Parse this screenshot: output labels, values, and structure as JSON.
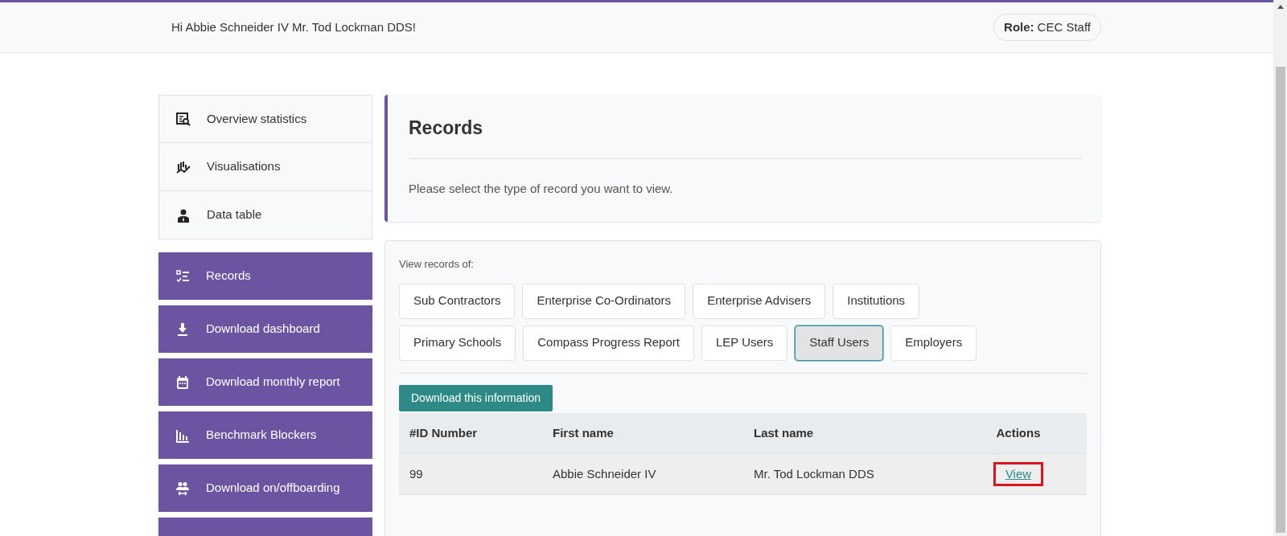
{
  "header": {
    "greeting": "Hi Abbie Schneider IV Mr. Tod Lockman DDS!",
    "role_label": "Role:",
    "role_value": "CEC Staff"
  },
  "sidebar": {
    "items": [
      {
        "kind": "light",
        "label": "Overview statistics"
      },
      {
        "kind": "light",
        "label": "Visualisations"
      },
      {
        "kind": "light",
        "label": "Data table"
      },
      {
        "kind": "purple",
        "label": "Records"
      },
      {
        "kind": "purple",
        "label": "Download dashboard"
      },
      {
        "kind": "purple",
        "label": "Download monthly report"
      },
      {
        "kind": "purple",
        "label": "Benchmark Blockers"
      },
      {
        "kind": "purple",
        "label": "Download on/offboarding"
      },
      {
        "kind": "purple"
      }
    ]
  },
  "records": {
    "title": "Records",
    "description": "Please select the type of record you want to view."
  },
  "selector": {
    "label": "View records of:",
    "options": [
      {
        "label": "Sub Contractors",
        "selected": false
      },
      {
        "label": "Enterprise Co-Ordinators",
        "selected": false
      },
      {
        "label": "Enterprise Advisers",
        "selected": false
      },
      {
        "label": "Institutions",
        "selected": false
      },
      {
        "label": "Primary Schools",
        "selected": false
      },
      {
        "label": "Compass Progress Report",
        "selected": false
      },
      {
        "label": "LEP Users",
        "selected": false
      },
      {
        "label": "Staff Users",
        "selected": true
      },
      {
        "label": "Employers",
        "selected": false
      }
    ],
    "download_button": "Download this information"
  },
  "table": {
    "columns": [
      "#ID Number",
      "First name",
      "Last name",
      "Actions"
    ],
    "rows": [
      {
        "cells": [
          "99",
          "Abbie Schneider IV",
          "Mr. Tod Lockman DDS"
        ],
        "action": "View",
        "highlighted": true
      }
    ]
  }
}
